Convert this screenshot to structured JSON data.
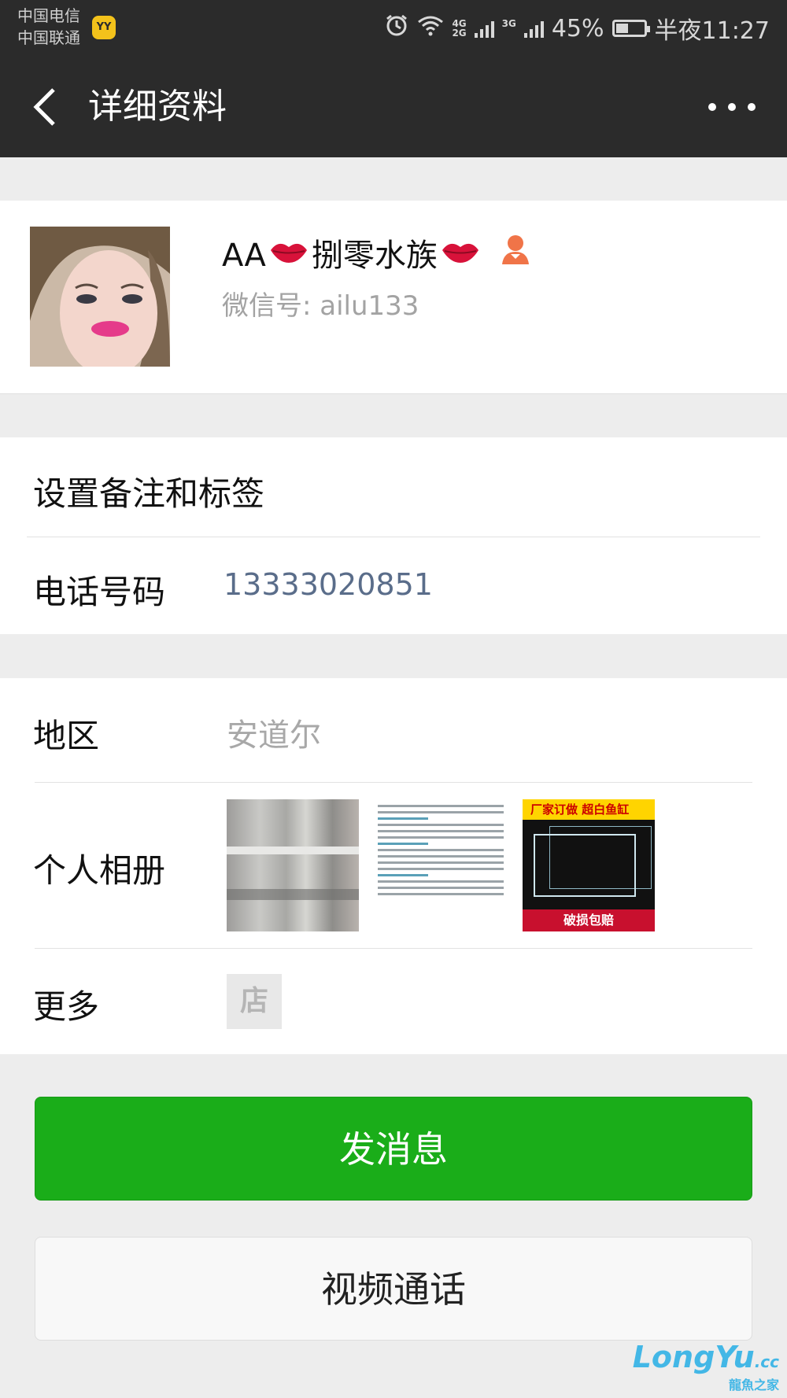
{
  "status_bar": {
    "carrier1": "中国电信",
    "carrier2": "中国联通",
    "yy_badge": "YY",
    "net1_top": "4G",
    "net1_bottom": "2G",
    "net2": "3G",
    "battery": "45%",
    "battery_level": 0.45,
    "time": "半夜11:27"
  },
  "nav": {
    "title": "详细资料"
  },
  "profile": {
    "nickname_prefix": "AA",
    "nickname_main": "捌零水族",
    "wechat_id": "微信号: ailu133"
  },
  "info": {
    "remark_label": "设置备注和标签",
    "phone_label": "电话号码",
    "phone_value": "13333020851"
  },
  "details": {
    "region_label": "地区",
    "region_value": "安道尔",
    "album_label": "个人相册",
    "more_label": "更多",
    "shop_icon_text": "店",
    "thumb3_banner": "厂家订做  超白鱼缸",
    "thumb3_footer": "破损包赔"
  },
  "actions": {
    "send_message": "发消息",
    "video_call": "视频通话"
  },
  "watermark": {
    "main": "LongYu",
    "suffix": ".cc",
    "sub": "龍魚之家"
  },
  "colors": {
    "header_bg": "#2b2b2b",
    "page_bg": "#ededed",
    "primary_green": "#1aad19",
    "phone_link": "#5a6d8a"
  }
}
